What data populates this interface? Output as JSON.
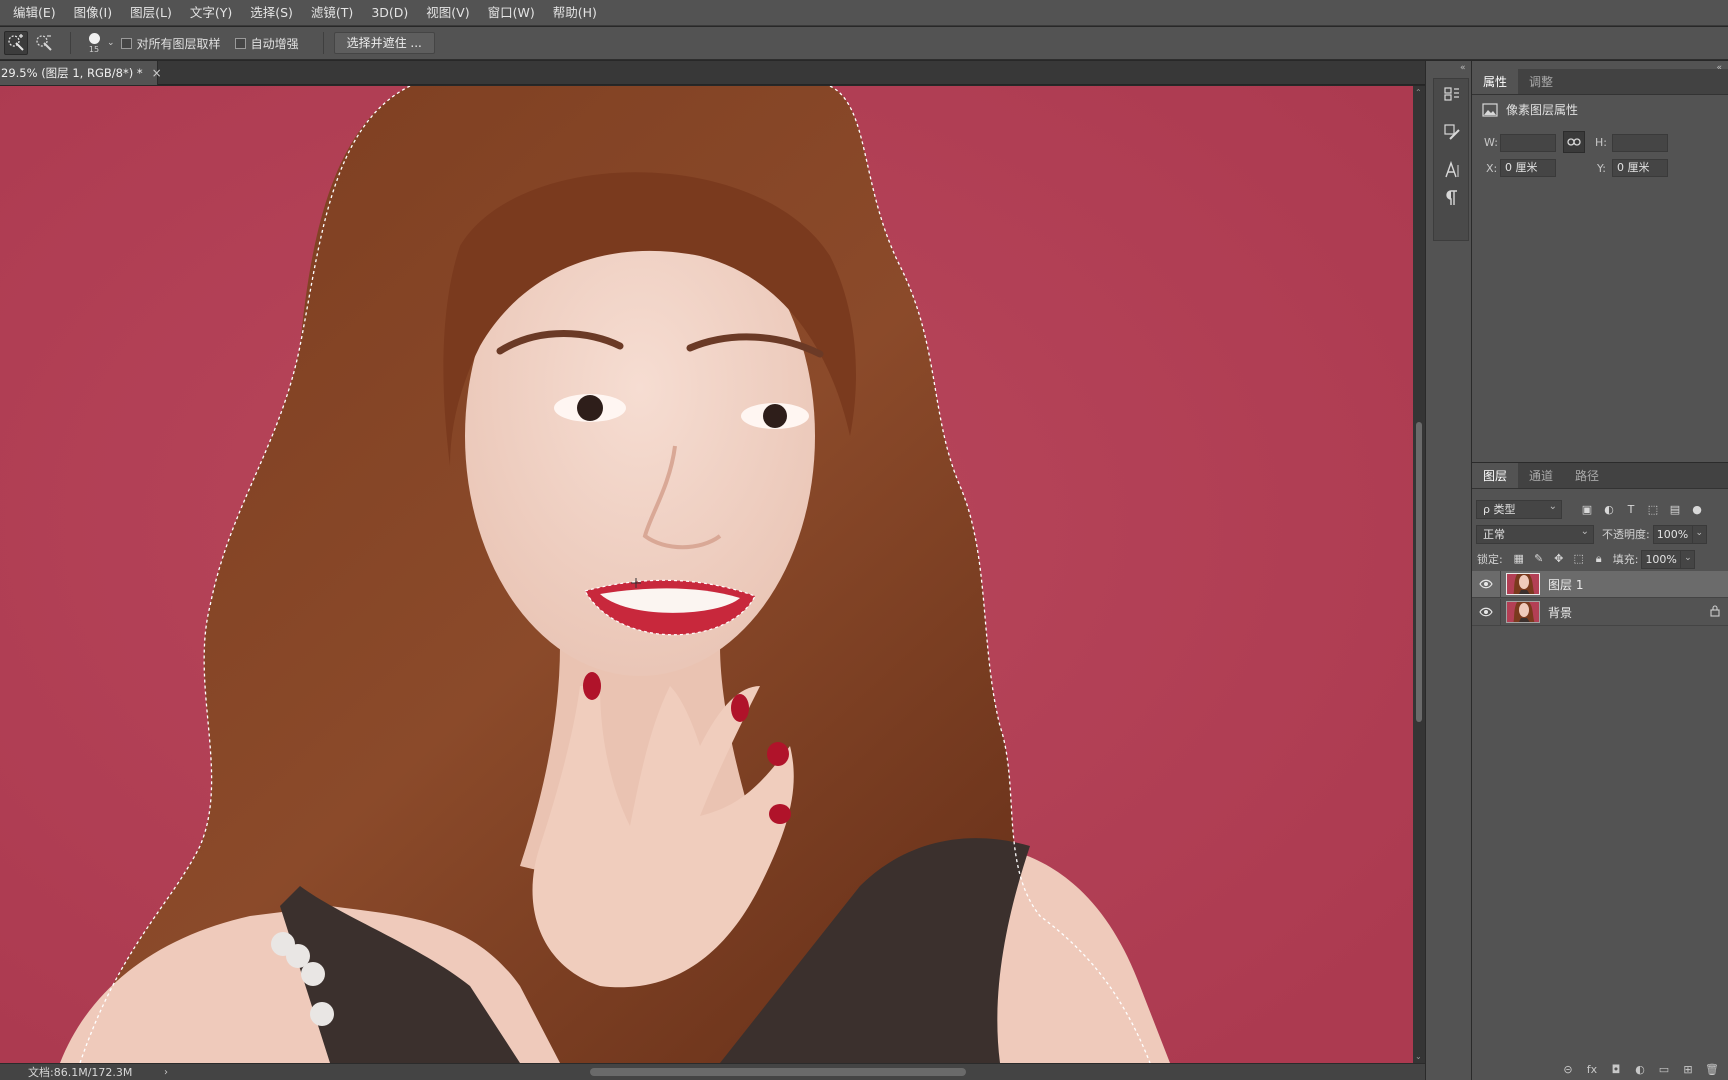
{
  "menu": [
    "编辑(E)",
    "图像(I)",
    "图层(L)",
    "文字(Y)",
    "选择(S)",
    "滤镜(T)",
    "3D(D)",
    "视图(V)",
    "窗口(W)",
    "帮助(H)"
  ],
  "options": {
    "brush_size": "15",
    "sample_all_layers": "对所有图层取样",
    "auto_enhance": "自动增强",
    "select_and_mask": "选择并遮住 ..."
  },
  "document_tab": {
    "title": "29.5% (图层 1, RGB/8*) *",
    "close": "×"
  },
  "status": {
    "doc_size": "文档:86.1M/172.3M"
  },
  "properties_panel": {
    "tabs": [
      "属性",
      "调整"
    ],
    "active_tab": "属性",
    "header": "像素图层属性",
    "w_label": "W:",
    "w_value": "",
    "h_label": "H:",
    "h_value": "",
    "x_label": "X:",
    "x_value": "0 厘米",
    "y_label": "Y:",
    "y_value": "0 厘米"
  },
  "layers_panel": {
    "tabs": [
      "图层",
      "通道",
      "路径"
    ],
    "active_tab": "图层",
    "filter_kind": "ρ 类型",
    "blend_mode": "正常",
    "opacity_label": "不透明度:",
    "opacity": "100%",
    "lock_label": "锁定:",
    "fill_label": "填充:",
    "fill": "100%",
    "layers": [
      {
        "name": "图层 1",
        "selected": true,
        "visible": true,
        "locked": false
      },
      {
        "name": "背景",
        "selected": false,
        "visible": true,
        "locked": true
      }
    ]
  },
  "colors": {
    "canvas_background": "#b33f55",
    "hair": "#7a3a1e",
    "panel": "#535353",
    "selected_layer": "#6b6b6b"
  }
}
